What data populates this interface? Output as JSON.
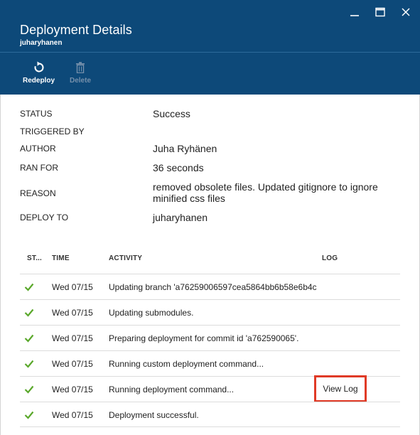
{
  "blade": {
    "title": "Deployment Details",
    "subtitle": "juharyhanen"
  },
  "window_controls": [
    {
      "name": "minimize",
      "icon": "minimize-icon"
    },
    {
      "name": "maximize",
      "icon": "maximize-icon"
    },
    {
      "name": "close",
      "icon": "close-icon"
    }
  ],
  "commands": {
    "redeploy": {
      "label": "Redeploy",
      "icon": "refresh-icon",
      "enabled": true
    },
    "delete": {
      "label": "Delete",
      "icon": "trash-icon",
      "enabled": false
    }
  },
  "summary": {
    "status": {
      "label": "STATUS",
      "value": "Success"
    },
    "triggered_by": {
      "label": "TRIGGERED BY",
      "value": ""
    },
    "author": {
      "label": "AUTHOR",
      "value": "Juha Ryhänen"
    },
    "ran_for": {
      "label": "RAN FOR",
      "value": "36 seconds"
    },
    "reason": {
      "label": "REASON",
      "value": "removed obsolete files. Updated gitignore to ignore minified css files"
    },
    "deploy_to": {
      "label": "DEPLOY TO",
      "value": "juharyhanen"
    }
  },
  "table": {
    "headers": {
      "status": "ST...",
      "time": "TIME",
      "activity": "ACTIVITY",
      "log": "LOG"
    },
    "rows": [
      {
        "status": "success",
        "time": "Wed 07/15",
        "activity": "Updating branch 'a76259006597cea5864bb6b58e6b4c",
        "log": ""
      },
      {
        "status": "success",
        "time": "Wed 07/15",
        "activity": "Updating submodules.",
        "log": ""
      },
      {
        "status": "success",
        "time": "Wed 07/15",
        "activity": "Preparing deployment for commit id 'a762590065'.",
        "log": ""
      },
      {
        "status": "success",
        "time": "Wed 07/15",
        "activity": "Running custom deployment command...",
        "log": ""
      },
      {
        "status": "success",
        "time": "Wed 07/15",
        "activity": "Running deployment command...",
        "log": "View Log"
      },
      {
        "status": "success",
        "time": "Wed 07/15",
        "activity": "Deployment successful.",
        "log": ""
      }
    ]
  },
  "colors": {
    "header_bg": "#0d4979",
    "success_check": "#5aa82b",
    "highlight_border": "#e03a26"
  }
}
